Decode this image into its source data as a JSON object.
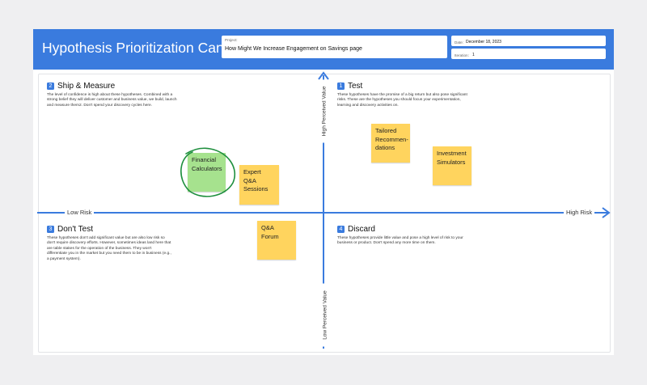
{
  "header": {
    "title": "Hypothesis Prioritization Canvas",
    "project_label": "Project:",
    "project_value": "How Might We Increase Engagement on Savings page",
    "date_label": "Date:",
    "date_value": "December 18, 2023",
    "iteration_label": "Iteration:",
    "iteration_value": "1"
  },
  "axes": {
    "low_risk": "Low Risk",
    "high_risk": "High Risk",
    "high_value": "High Perceived Value",
    "low_value": "Low Perceived Value"
  },
  "quadrants": {
    "ship": {
      "number": "2",
      "title": "Ship & Measure",
      "description": "The level of confidence is high about these hypotheses. Combined with a strong belief they will deliver customer and business value, we build, launch and measure them2. Don't spend your discovery cycles here."
    },
    "test": {
      "number": "1",
      "title": "Test",
      "description": "These hypotheses have the promise of a big return but also pose significant risks. These are the hypotheses you should focus your experimentation, learning and discovery activities on."
    },
    "dont_test": {
      "number": "3",
      "title": "Don't Test",
      "description": "These hypotheses don't add significant value but are also low risk so don't require discovery efforts. However, sometimes ideas land here that are table stakes for the operation of the business. They won't differentiate you in the market but you need them to be in business (e.g., a payment system)."
    },
    "discard": {
      "number": "4",
      "title": "Discard",
      "description": "These hypotheses provide little value and pose a high level of risk to your business or product. Don't spend any more time on them."
    }
  },
  "notes": {
    "financial_calculators": "Financial Calculators",
    "expert_qa": "Expert Q&A Sessions",
    "tailored": "Tailored Recommen-dations",
    "investment": "Investment Simulators",
    "qa_forum": "Q&A Forum"
  },
  "colors": {
    "accent": "#3a7bde",
    "sticky_yellow": "#ffd45e",
    "sticky_green": "#a6e28e",
    "circle_green": "#1e8f3e"
  }
}
